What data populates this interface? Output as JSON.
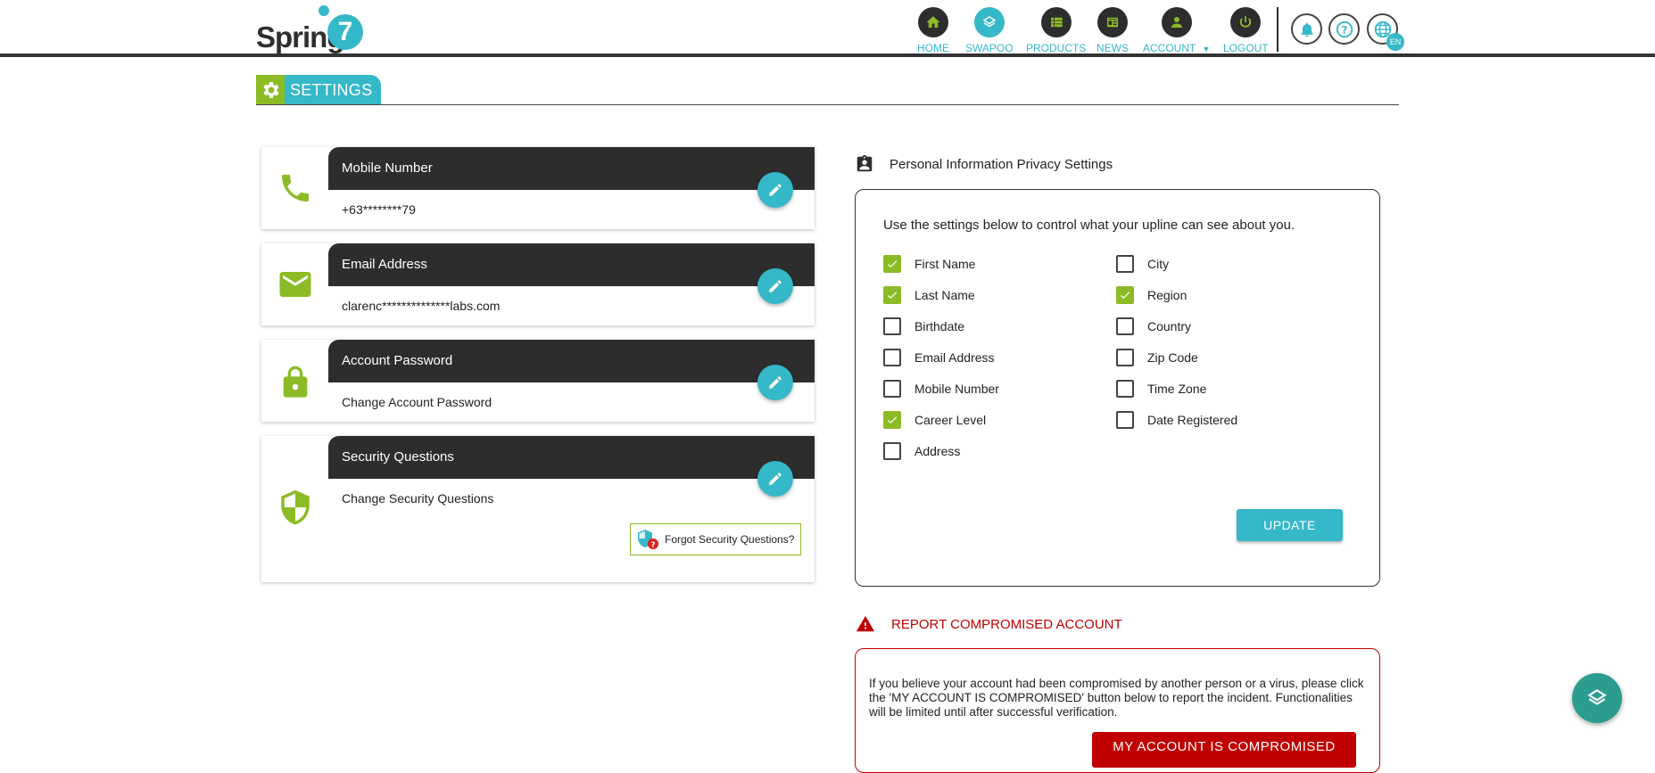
{
  "brand": {
    "logo_text": "Spring",
    "logo_number": "7"
  },
  "nav": {
    "items": [
      {
        "label": "HOME",
        "icon": "home-icon"
      },
      {
        "label": "SWAPOO",
        "icon": "swapoo-icon"
      },
      {
        "label": "PRODUCTS",
        "icon": "products-icon"
      },
      {
        "label": "NEWS",
        "icon": "news-icon"
      },
      {
        "label": "ACCOUNT",
        "icon": "account-icon"
      },
      {
        "label": "LOGOUT",
        "icon": "power-icon"
      }
    ],
    "language_badge": "EN"
  },
  "page": {
    "title": "SETTINGS"
  },
  "cards": [
    {
      "title": "Mobile Number",
      "value": "+63********79",
      "icon": "phone-icon"
    },
    {
      "title": "Email Address",
      "value": "clarenc**************labs.com",
      "icon": "mail-icon"
    },
    {
      "title": "Account Password",
      "value": "Change Account Password",
      "icon": "lock-icon"
    },
    {
      "title": "Security Questions",
      "value": "Change Security Questions",
      "icon": "shield-icon",
      "extra_button": "Forgot Security Questions?"
    }
  ],
  "privacy": {
    "heading": "Personal Information Privacy Settings",
    "intro": "Use the settings below to control what your upline can see about you.",
    "left": [
      {
        "label": "First Name",
        "checked": true
      },
      {
        "label": "Last Name",
        "checked": true
      },
      {
        "label": "Birthdate",
        "checked": false
      },
      {
        "label": "Email Address",
        "checked": false
      },
      {
        "label": "Mobile Number",
        "checked": false
      },
      {
        "label": "Career Level",
        "checked": true
      },
      {
        "label": "Address",
        "checked": false
      }
    ],
    "right": [
      {
        "label": "City",
        "checked": false
      },
      {
        "label": "Region",
        "checked": true
      },
      {
        "label": "Country",
        "checked": false
      },
      {
        "label": "Zip Code",
        "checked": false
      },
      {
        "label": "Time Zone",
        "checked": false
      },
      {
        "label": "Date Registered",
        "checked": false
      }
    ],
    "update_label": "UPDATE"
  },
  "report": {
    "heading": "REPORT COMPROMISED ACCOUNT",
    "text": "If you believe your account had been compromised by another person or a virus, please click the 'MY ACCOUNT IS COMPROMISED' button below to report the incident. Functionalities will be limited until after successful verification.",
    "button_label": "MY ACCOUNT IS COMPROMISED"
  },
  "colors": {
    "accent": "#35b8c8",
    "green": "#8cbb26",
    "dark": "#2d2d2d",
    "danger": "#c00000"
  }
}
